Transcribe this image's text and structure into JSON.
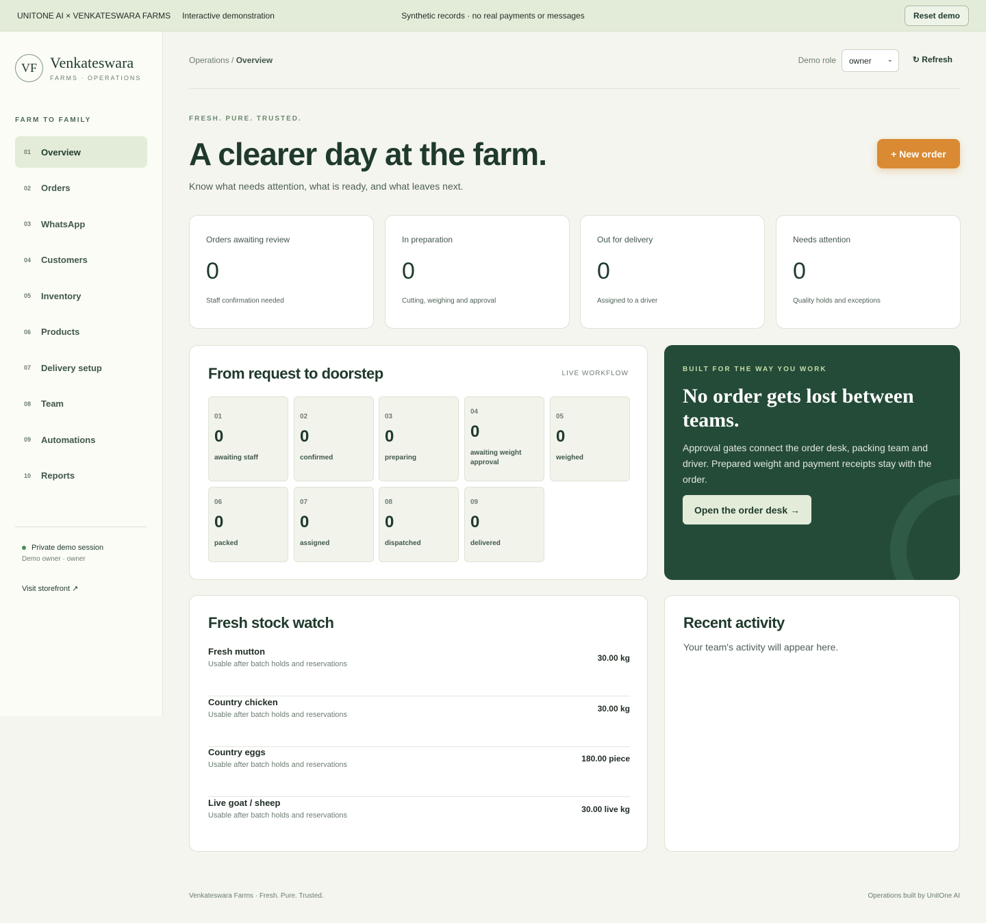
{
  "topbar": {
    "brand": "UNITONE AI × VENKATESWARA FARMS",
    "mode": "Interactive demonstration",
    "notice": "Synthetic records · no real payments or messages",
    "reset_label": "Reset demo"
  },
  "sidebar": {
    "logo_initials": "VF",
    "logo_title": "Venkateswara",
    "logo_subtitle": "FARMS · OPERATIONS",
    "caption": "FARM TO FAMILY",
    "items": [
      {
        "num": "01",
        "label": "Overview"
      },
      {
        "num": "02",
        "label": "Orders"
      },
      {
        "num": "03",
        "label": "WhatsApp"
      },
      {
        "num": "04",
        "label": "Customers"
      },
      {
        "num": "05",
        "label": "Inventory"
      },
      {
        "num": "06",
        "label": "Products"
      },
      {
        "num": "07",
        "label": "Delivery setup"
      },
      {
        "num": "08",
        "label": "Team"
      },
      {
        "num": "09",
        "label": "Automations"
      },
      {
        "num": "10",
        "label": "Reports"
      }
    ],
    "session_label": "Private demo session",
    "session_user": "Demo owner · owner",
    "storefront_label": "Visit storefront ↗"
  },
  "header": {
    "breadcrumb_parent": "Operations /",
    "breadcrumb_current": "Overview",
    "role_label": "Demo role",
    "role_value": "owner",
    "refresh_label": "↻ Refresh"
  },
  "hero": {
    "eyebrow": "FRESH. PURE. TRUSTED.",
    "title": "A clearer day at the farm.",
    "subtitle": "Know what needs attention, what is ready, and what leaves next.",
    "new_order_label": "+ New order"
  },
  "stats": [
    {
      "title": "Orders awaiting review",
      "value": "0",
      "sub": "Staff confirmation needed"
    },
    {
      "title": "In preparation",
      "value": "0",
      "sub": "Cutting, weighing and approval"
    },
    {
      "title": "Out for delivery",
      "value": "0",
      "sub": "Assigned to a driver"
    },
    {
      "title": "Needs attention",
      "value": "0",
      "sub": "Quality holds and exceptions"
    }
  ],
  "workflow": {
    "title": "From request to doorstep",
    "tag": "LIVE WORKFLOW",
    "steps": [
      {
        "num": "01",
        "count": "0",
        "label": "awaiting staff"
      },
      {
        "num": "02",
        "count": "0",
        "label": "confirmed"
      },
      {
        "num": "03",
        "count": "0",
        "label": "preparing"
      },
      {
        "num": "04",
        "count": "0",
        "label": "awaiting weight approval"
      },
      {
        "num": "05",
        "count": "0",
        "label": "weighed"
      },
      {
        "num": "06",
        "count": "0",
        "label": "packed"
      },
      {
        "num": "07",
        "count": "0",
        "label": "assigned"
      },
      {
        "num": "08",
        "count": "0",
        "label": "dispatched"
      },
      {
        "num": "09",
        "count": "0",
        "label": "delivered"
      }
    ]
  },
  "promo": {
    "eyebrow": "BUILT FOR THE WAY YOU WORK",
    "title": "No order gets lost between teams.",
    "text": "Approval gates connect the order desk, packing team and driver. Prepared weight and payment receipts stay with the order.",
    "button_label": "Open the order desk →"
  },
  "stock": {
    "title": "Fresh stock watch",
    "items": [
      {
        "name": "Fresh mutton",
        "note": "Usable after batch holds and reservations",
        "qty": "30.00 kg"
      },
      {
        "name": "Country chicken",
        "note": "Usable after batch holds and reservations",
        "qty": "30.00 kg"
      },
      {
        "name": "Country eggs",
        "note": "Usable after batch holds and reservations",
        "qty": "180.00 piece"
      },
      {
        "name": "Live goat / sheep",
        "note": "Usable after batch holds and reservations",
        "qty": "30.00 live kg"
      }
    ]
  },
  "activity": {
    "title": "Recent activity",
    "empty": "Your team's activity will appear here."
  },
  "footer": {
    "left": "Venkateswara Farms · Fresh. Pure. Trusted.",
    "right": "Operations built by UnitOne AI"
  },
  "colors": {
    "accent": "#d98a33",
    "brand_dark": "#244b38",
    "brand_light": "#e3ecd9"
  }
}
